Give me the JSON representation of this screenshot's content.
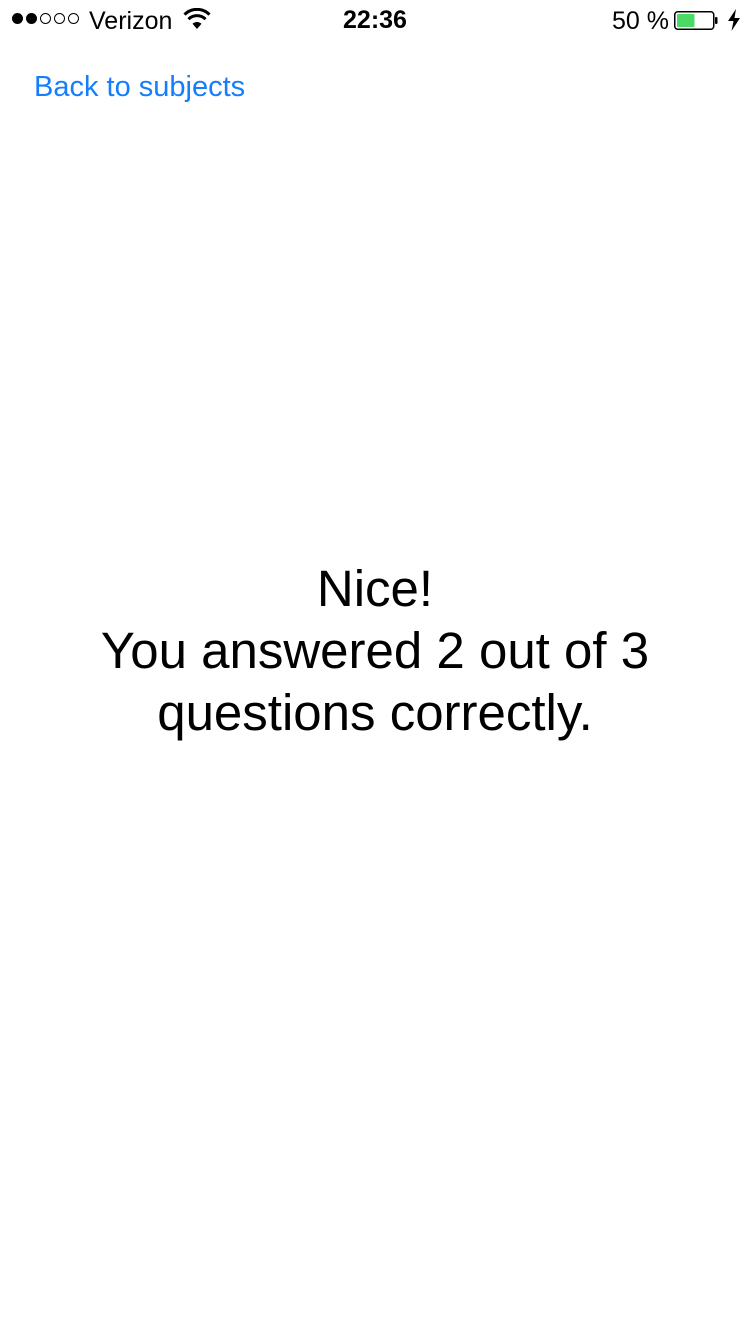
{
  "status_bar": {
    "signal_bars_filled": 2,
    "signal_bars_total": 5,
    "carrier": "Verizon",
    "time": "22:36",
    "battery_percent": "50 %",
    "battery_level": 0.5,
    "battery_color": "#4cd964",
    "charging_icon": "bolt-icon",
    "wifi_icon": "wifi-icon"
  },
  "nav": {
    "back_label": "Back to subjects",
    "link_color": "#147efb"
  },
  "result": {
    "headline": "Nice!",
    "line1": "You answered 2 out of 3",
    "line2": "questions correctly."
  }
}
